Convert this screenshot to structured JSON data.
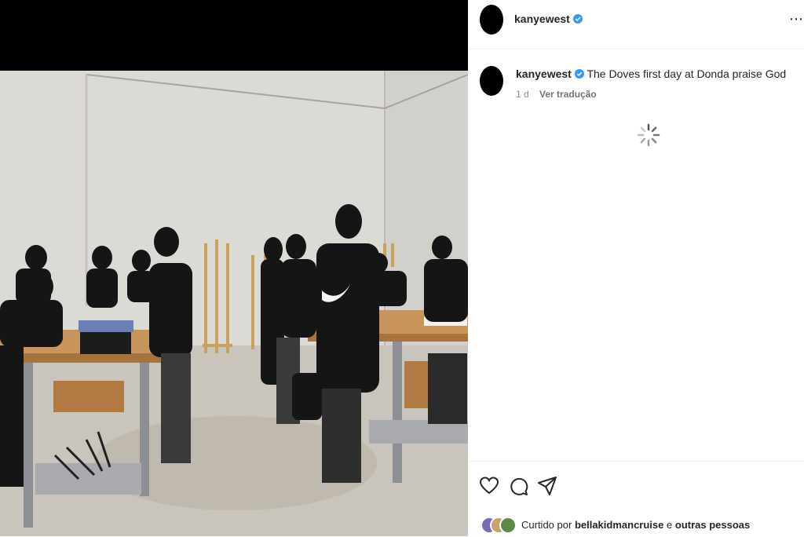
{
  "post": {
    "username": "kanyewest",
    "caption_username": "kanyewest",
    "caption": "The Doves first day at Donda praise God",
    "time_ago": "1 d",
    "translate_label": "Ver tradução"
  },
  "likes": {
    "prefix": "Curtido por",
    "user": "bellakidmancruise",
    "conjunction": "e",
    "others": "outras pessoas"
  },
  "icons": {
    "verified": "verified-badge-icon",
    "like": "heart-icon",
    "comment": "comment-bubble-icon",
    "share": "paper-plane-icon",
    "loading": "loading-spinner-icon",
    "more": "more-options-icon"
  },
  "colors": {
    "verified_blue": "#3897f0",
    "text": "#262626",
    "muted": "#8e8e8e"
  }
}
